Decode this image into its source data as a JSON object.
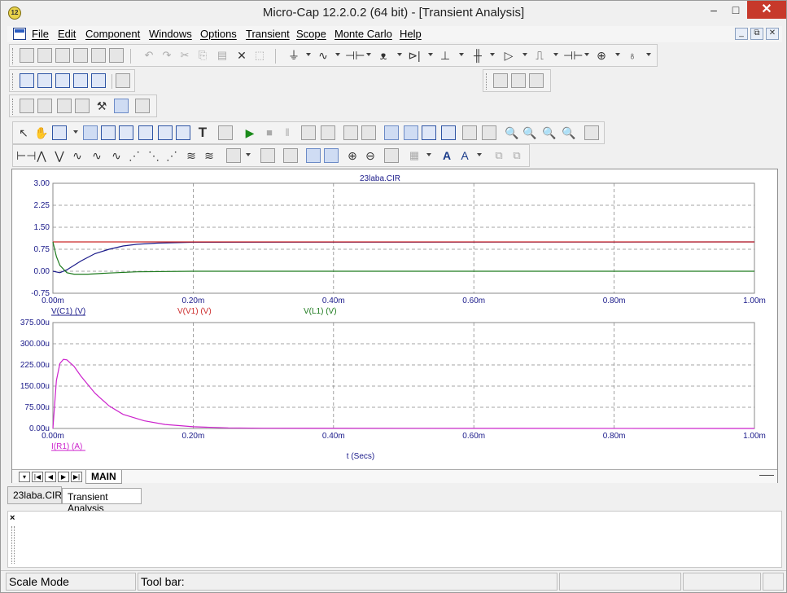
{
  "window": {
    "title": "Micro-Cap 12.2.0.2 (64 bit) - [Transient Analysis]",
    "app_icon_text": "12",
    "minimize": "–",
    "maximize": "□",
    "close": "✕"
  },
  "menu": {
    "items": [
      "File",
      "Edit",
      "Component",
      "Windows",
      "Options",
      "Transient",
      "Scope",
      "Monte Carlo",
      "Help"
    ],
    "mdi_buttons": [
      "_",
      "⧉",
      "✕"
    ]
  },
  "plot": {
    "title": "23laba.CIR",
    "x_axis_title": "t (Secs)"
  },
  "chart_data": [
    {
      "type": "line",
      "title": "23laba.CIR",
      "xlabel": "",
      "ylabel": "",
      "xlim": [
        0,
        0.001
      ],
      "ylim": [
        -0.75,
        3.0
      ],
      "x_ticks": [
        "0.00m",
        "0.20m",
        "0.40m",
        "0.60m",
        "0.80m",
        "1.00m"
      ],
      "y_ticks": [
        "3.00",
        "2.25",
        "1.50",
        "0.75",
        "0.00",
        "-0.75"
      ],
      "grid": true,
      "legend_placement": "bottom",
      "series": [
        {
          "name": "V(C1) (V)",
          "color": "#1a1a8a",
          "x": [
            0,
            1e-05,
            2e-05,
            4e-05,
            6e-05,
            8e-05,
            0.0001,
            0.00012,
            0.00015,
            0.0002,
            0.001
          ],
          "y": [
            0,
            -0.05,
            0.05,
            0.35,
            0.6,
            0.75,
            0.86,
            0.92,
            0.96,
            0.99,
            1.0
          ]
        },
        {
          "name": "V(V1) (V)",
          "color": "#cc2b2b",
          "x": [
            0,
            0.001
          ],
          "y": [
            1.0,
            1.0
          ]
        },
        {
          "name": "V(L1) (V)",
          "color": "#1d7a1d",
          "x": [
            0,
            5e-06,
            1e-05,
            2e-05,
            3e-05,
            5e-05,
            8e-05,
            0.00012,
            0.0002,
            0.001
          ],
          "y": [
            1.0,
            0.5,
            0.2,
            -0.05,
            -0.1,
            -0.1,
            -0.06,
            -0.02,
            0.0,
            0.0
          ]
        }
      ]
    },
    {
      "type": "line",
      "title": "",
      "xlabel": "t (Secs)",
      "ylabel": "",
      "xlim": [
        0,
        0.001
      ],
      "ylim": [
        0,
        0.000375
      ],
      "x_ticks": [
        "0.00m",
        "0.20m",
        "0.40m",
        "0.60m",
        "0.80m",
        "1.00m"
      ],
      "y_ticks": [
        "375.00u",
        "300.00u",
        "225.00u",
        "150.00u",
        "75.00u",
        "0.00u"
      ],
      "grid": true,
      "legend_placement": "bottom",
      "series": [
        {
          "name": "I(R1) (A)",
          "color": "#cc22cc",
          "x": [
            0,
            5e-06,
            1e-05,
            1.5e-05,
            2e-05,
            3e-05,
            4e-05,
            6e-05,
            8e-05,
            0.0001,
            0.00013,
            0.00016,
            0.0002,
            0.00025,
            0.0003,
            0.001
          ],
          "y": [
            0,
            0.00017,
            0.00023,
            0.000245,
            0.000243,
            0.00022,
            0.000185,
            0.000125,
            8e-05,
            5e-05,
            2.7e-05,
            1.4e-05,
            6e-06,
            2e-06,
            1e-06,
            0
          ]
        }
      ]
    }
  ],
  "tabs": {
    "sheet_tab": "MAIN",
    "nav_buttons": [
      "▾",
      "|◀",
      "◀",
      "▶",
      "▶|"
    ],
    "documents": [
      "23laba.CIR",
      "Transient Analysis"
    ]
  },
  "output": {
    "close_label": "×"
  },
  "status": {
    "mode": "Scale Mode",
    "toolbar": "Tool bar:"
  }
}
